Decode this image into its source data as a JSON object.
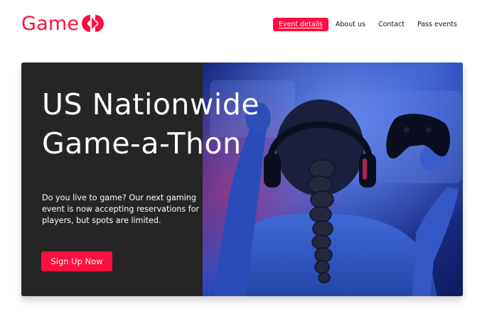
{
  "brand": {
    "name": "Game",
    "icon": "pacman-mark-icon",
    "color": "#ff0f3f"
  },
  "nav": {
    "items": [
      {
        "label": "Event details",
        "active": true
      },
      {
        "label": "About us",
        "active": false
      },
      {
        "label": "Contact",
        "active": false
      },
      {
        "label": "Pass events",
        "active": false
      }
    ]
  },
  "hero": {
    "title_line1": "US Nationwide",
    "title_line2": "Game-a-Thon",
    "description": "Do you live to game? Our next gaming event is now accepting reservations for players, but spots are limited.",
    "cta_label": "Sign Up Now",
    "photo": "person-with-headphones-and-game-controller",
    "panel_color": "#252525"
  }
}
